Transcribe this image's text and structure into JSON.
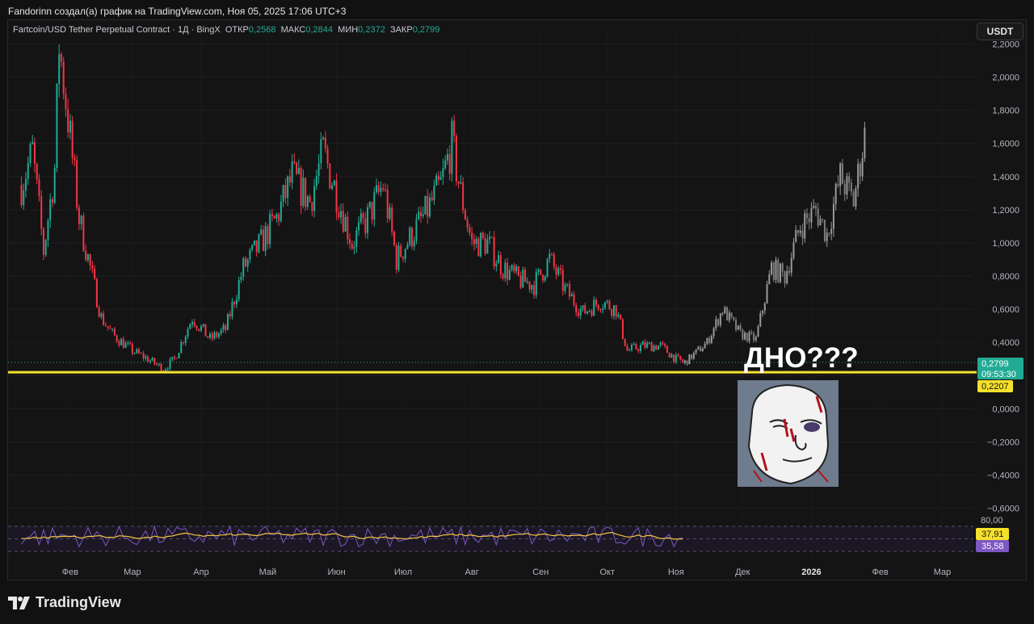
{
  "header": {
    "caption": "Fandorinn создал(а) график на TradingView.com, Ноя 05, 2025 17:06 UTC+3"
  },
  "legend": {
    "symbol": "Fartcoin/USD Tether Perpetual Contract · 1Д · BingX",
    "open_label": "ОТКР",
    "open_value": "0,2568",
    "high_label": "МАКС",
    "high_value": "0,2844",
    "low_label": "МИН",
    "low_value": "0,2372",
    "close_label": "ЗАКР",
    "close_value": "0,2799"
  },
  "currency_button": "USDT",
  "brand": {
    "name": "TradingView"
  },
  "annotation": {
    "text": "ДНО???",
    "image_icon": "wojak-face-icon"
  },
  "price_badges": {
    "last_price": "0,2799",
    "countdown": "09:53:30",
    "line_price": "0,2207"
  },
  "rsi_badges": {
    "rsi": "37,91",
    "rsi_ma": "35,58",
    "top_label": "80,00"
  },
  "colors": {
    "up": "#22ab94",
    "down": "#f23645",
    "projection": "#9a9a9a",
    "support": "#f5e12c",
    "rsi_line": "#7e57c2",
    "rsi_ma": "#f5c542",
    "background": "#141415"
  },
  "chart_data": {
    "type": "candlestick",
    "title": "Fartcoin/USD Tether Perpetual Contract · 1Д · BingX",
    "y_ticks": [
      "2,2000",
      "2,0000",
      "1,8000",
      "1,6000",
      "1,4000",
      "1,2000",
      "1,0000",
      "0,8000",
      "0,6000",
      "0,4000",
      "0,2000",
      "0,0000",
      "−0,2000",
      "−0,4000",
      "−0,6000"
    ],
    "ylim": [
      -0.65,
      2.27
    ],
    "x_ticks": [
      {
        "label": "Фев",
        "x": "2025-02-01"
      },
      {
        "label": "Мар",
        "x": "2025-03-01"
      },
      {
        "label": "Апр",
        "x": "2025-04-01"
      },
      {
        "label": "Май",
        "x": "2025-05-01"
      },
      {
        "label": "Июн",
        "x": "2025-06-01"
      },
      {
        "label": "Июл",
        "x": "2025-07-01"
      },
      {
        "label": "Авг",
        "x": "2025-08-01"
      },
      {
        "label": "Сен",
        "x": "2025-09-01"
      },
      {
        "label": "Окт",
        "x": "2025-10-01"
      },
      {
        "label": "Ноя",
        "x": "2025-11-01"
      },
      {
        "label": "Дек",
        "x": "2025-12-01"
      },
      {
        "label": "2026",
        "x": "2026-01-01"
      },
      {
        "label": "Фев",
        "x": "2026-02-01"
      },
      {
        "label": "Мар",
        "x": "2026-03-01"
      }
    ],
    "xlim": [
      "2025-01-04",
      "2026-03-15"
    ],
    "support_level": 0.2207,
    "last_close": 0.2799,
    "close_path": [
      [
        "2025-01-10",
        1.35
      ],
      [
        "2025-01-15",
        1.55
      ],
      [
        "2025-01-20",
        0.95
      ],
      [
        "2025-01-25",
        1.45
      ],
      [
        "2025-01-27",
        2.2
      ],
      [
        "2025-01-31",
        1.75
      ],
      [
        "2025-02-05",
        1.15
      ],
      [
        "2025-02-10",
        0.85
      ],
      [
        "2025-02-15",
        0.55
      ],
      [
        "2025-02-20",
        0.45
      ],
      [
        "2025-03-01",
        0.35
      ],
      [
        "2025-03-08",
        0.3
      ],
      [
        "2025-03-15",
        0.24
      ],
      [
        "2025-03-20",
        0.3
      ],
      [
        "2025-03-28",
        0.55
      ],
      [
        "2025-04-05",
        0.42
      ],
      [
        "2025-04-12",
        0.48
      ],
      [
        "2025-04-20",
        0.85
      ],
      [
        "2025-04-28",
        1.0
      ],
      [
        "2025-05-05",
        1.15
      ],
      [
        "2025-05-12",
        1.4
      ],
      [
        "2025-05-20",
        1.25
      ],
      [
        "2025-05-26",
        1.55
      ],
      [
        "2025-06-01",
        1.3
      ],
      [
        "2025-06-08",
        1.0
      ],
      [
        "2025-06-15",
        1.15
      ],
      [
        "2025-06-22",
        1.35
      ],
      [
        "2025-06-28",
        0.9
      ],
      [
        "2025-07-05",
        1.05
      ],
      [
        "2025-07-12",
        1.2
      ],
      [
        "2025-07-18",
        1.35
      ],
      [
        "2025-07-23",
        1.6
      ],
      [
        "2025-07-27",
        1.3
      ],
      [
        "2025-08-01",
        1.0
      ],
      [
        "2025-08-08",
        1.0
      ],
      [
        "2025-08-15",
        0.85
      ],
      [
        "2025-08-22",
        0.78
      ],
      [
        "2025-08-29",
        0.75
      ],
      [
        "2025-09-05",
        0.9
      ],
      [
        "2025-09-12",
        0.72
      ],
      [
        "2025-09-20",
        0.58
      ],
      [
        "2025-09-28",
        0.65
      ],
      [
        "2025-10-05",
        0.6
      ],
      [
        "2025-10-10",
        0.35
      ],
      [
        "2025-10-17",
        0.38
      ],
      [
        "2025-10-25",
        0.38
      ],
      [
        "2025-11-01",
        0.3
      ],
      [
        "2025-11-05",
        0.2799
      ]
    ],
    "projection_path": [
      [
        "2025-11-05",
        0.28
      ],
      [
        "2025-11-15",
        0.4
      ],
      [
        "2025-11-22",
        0.6
      ],
      [
        "2025-11-30",
        0.45
      ],
      [
        "2025-12-07",
        0.42
      ],
      [
        "2025-12-14",
        0.85
      ],
      [
        "2025-12-20",
        0.8
      ],
      [
        "2025-12-27",
        1.1
      ],
      [
        "2026-01-03",
        1.2
      ],
      [
        "2026-01-08",
        1.05
      ],
      [
        "2026-01-14",
        1.4
      ],
      [
        "2026-01-20",
        1.25
      ],
      [
        "2026-01-25",
        1.65
      ]
    ],
    "indicators": [
      {
        "name": "RSI",
        "value": 37.91
      },
      {
        "name": "RSI MA",
        "value": 35.58
      }
    ]
  }
}
